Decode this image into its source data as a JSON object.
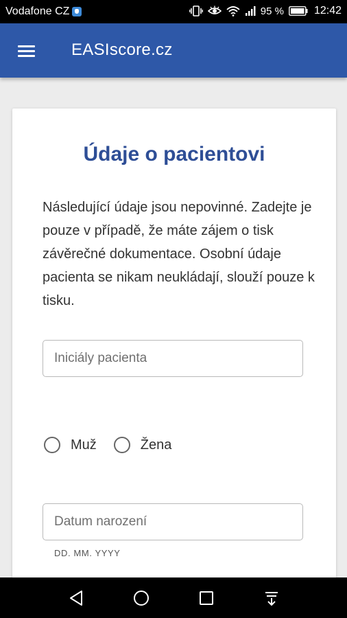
{
  "status_bar": {
    "carrier": "Vodafone CZ",
    "battery_percent": "95 %",
    "time": "12:42",
    "icons": [
      "carrier-shield-icon",
      "vibrate-icon",
      "eye-comfort-icon",
      "wifi-icon",
      "signal-icon",
      "battery-icon"
    ]
  },
  "app_bar": {
    "menu_icon": "hamburger-menu-icon",
    "title": "EASIscore.cz",
    "color": "#2e58a8"
  },
  "card": {
    "title": "Údaje o pacientovi",
    "title_color": "#2e4e96",
    "intro": "Následující údaje jsou nepovinné. Zadejte je pouze v případě, že máte zájem o tisk závěrečné dokumentace. Osobní údaje pacienta se nikam neukládají, slouží pouze k tisku.",
    "initials_field": {
      "placeholder": "Iniciály pacienta",
      "value": ""
    },
    "gender": {
      "options": [
        "Muž",
        "Žena"
      ],
      "selected": null
    },
    "birth_date_field": {
      "placeholder": "Datum narození",
      "value": "",
      "helper": "DD. MM. YYYY"
    }
  },
  "nav_bar": {
    "buttons": [
      "back-icon",
      "home-icon",
      "recents-icon",
      "notification-pull-icon"
    ]
  }
}
